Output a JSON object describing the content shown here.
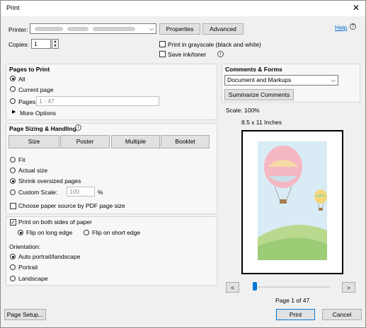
{
  "window": {
    "title": "Print"
  },
  "printer": {
    "label": "Printer:",
    "properties": "Properties",
    "advanced": "Advanced",
    "help": "Help"
  },
  "copies": {
    "label": "Copies:",
    "value": "1"
  },
  "options": {
    "grayscale": "Print in grayscale (black and white)",
    "save_ink": "Save ink/toner"
  },
  "pages": {
    "header": "Pages to Print",
    "all": "All",
    "current": "Current page",
    "pages": "Pages",
    "pages_placeholder": "1 - 47",
    "more": "More Options"
  },
  "sizing": {
    "header": "Page Sizing & Handling",
    "tabs": [
      "Size",
      "Poster",
      "Multiple",
      "Booklet"
    ],
    "fit": "Fit",
    "actual": "Actual size",
    "shrink": "Shrink oversized pages",
    "custom": "Custom Scale:",
    "custom_value": "100",
    "percent": "%",
    "paper_source": "Choose paper source by PDF page size"
  },
  "duplex": {
    "both_sides": "Print on both sides of paper",
    "long": "Flip on long edge",
    "short": "Flip on short edge"
  },
  "orientation": {
    "label": "Orientation:",
    "auto": "Auto portrait/landscape",
    "portrait": "Portrait",
    "landscape": "Landscape"
  },
  "comments": {
    "header": "Comments & Forms",
    "selected": "Document and Markups",
    "summarize": "Summarize Comments"
  },
  "preview": {
    "scale": "Scale: 100%",
    "paper": "8.5 x 11 Inches",
    "page_label": "Page 1 of 47",
    "prev": "<",
    "next": ">",
    "slider_position": 0.0
  },
  "footer": {
    "page_setup": "Page Setup...",
    "print": "Print",
    "cancel": "Cancel"
  },
  "colors": {
    "accent": "#0066cc",
    "window_bg": "#f0f0f0"
  }
}
